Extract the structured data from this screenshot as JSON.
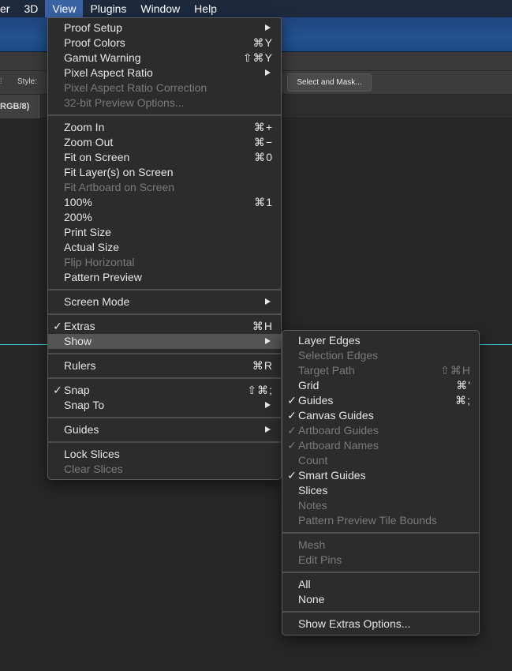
{
  "menubar": {
    "items": [
      "er",
      "3D",
      "View",
      "Plugins",
      "Window",
      "Help"
    ],
    "active": "View"
  },
  "options_bar": {
    "style_label": "Style:",
    "select_mask_label": "Select and Mask..."
  },
  "document_tab": {
    "label": "RGB/8)"
  },
  "colors": {
    "menubar_bg": "#1d2a3e",
    "menubar_active": "#3a63a6",
    "menu_bg": "#2c2c2c",
    "menu_highlight": "#545454",
    "guide_color": "#3fc6d1",
    "disabled_text": "#7a7a7a"
  },
  "view_menu": {
    "items": [
      {
        "label": "Proof Setup",
        "shortcut": "",
        "submenu": true
      },
      {
        "label": "Proof Colors",
        "shortcut": "⌘Y"
      },
      {
        "label": "Gamut Warning",
        "shortcut": "⇧⌘Y"
      },
      {
        "label": "Pixel Aspect Ratio",
        "shortcut": "",
        "submenu": true
      },
      {
        "label": "Pixel Aspect Ratio Correction",
        "disabled": true
      },
      {
        "label": "32-bit Preview Options...",
        "disabled": true
      },
      {
        "label": "Zoom In",
        "shortcut": "⌘+"
      },
      {
        "label": "Zoom Out",
        "shortcut": "⌘−"
      },
      {
        "label": "Fit on Screen",
        "shortcut": "⌘0"
      },
      {
        "label": "Fit Layer(s) on Screen"
      },
      {
        "label": "Fit Artboard on Screen",
        "disabled": true
      },
      {
        "label": "100%",
        "shortcut": "⌘1"
      },
      {
        "label": "200%"
      },
      {
        "label": "Print Size"
      },
      {
        "label": "Actual Size"
      },
      {
        "label": "Flip Horizontal",
        "disabled": true
      },
      {
        "label": "Pattern Preview"
      },
      {
        "label": "Screen Mode",
        "submenu": true
      },
      {
        "label": "Extras",
        "shortcut": "⌘H",
        "checked": true
      },
      {
        "label": "Show",
        "submenu": true,
        "highlighted": true
      },
      {
        "label": "Rulers",
        "shortcut": "⌘R"
      },
      {
        "label": "Snap",
        "shortcut": "⇧⌘;",
        "checked": true
      },
      {
        "label": "Snap To",
        "submenu": true
      },
      {
        "label": "Guides",
        "submenu": true
      },
      {
        "label": "Lock Slices"
      },
      {
        "label": "Clear Slices",
        "disabled": true
      }
    ]
  },
  "show_menu": {
    "items": [
      {
        "label": "Layer Edges"
      },
      {
        "label": "Selection Edges",
        "disabled": true
      },
      {
        "label": "Target Path",
        "shortcut": "⇧⌘H",
        "disabled": true
      },
      {
        "label": "Grid",
        "shortcut": "⌘'"
      },
      {
        "label": "Guides",
        "shortcut": "⌘;",
        "checked": true
      },
      {
        "label": "Canvas Guides",
        "checked": true
      },
      {
        "label": "Artboard Guides",
        "checked": true,
        "disabled": true
      },
      {
        "label": "Artboard Names",
        "checked": true,
        "disabled": true
      },
      {
        "label": "Count",
        "disabled": true
      },
      {
        "label": "Smart Guides",
        "checked": true
      },
      {
        "label": "Slices"
      },
      {
        "label": "Notes",
        "disabled": true
      },
      {
        "label": "Pattern Preview Tile Bounds",
        "disabled": true
      },
      {
        "label": "Mesh",
        "disabled": true
      },
      {
        "label": "Edit Pins",
        "disabled": true
      },
      {
        "label": "All"
      },
      {
        "label": "None"
      },
      {
        "label": "Show Extras Options..."
      }
    ]
  },
  "check_glyph": "✓"
}
